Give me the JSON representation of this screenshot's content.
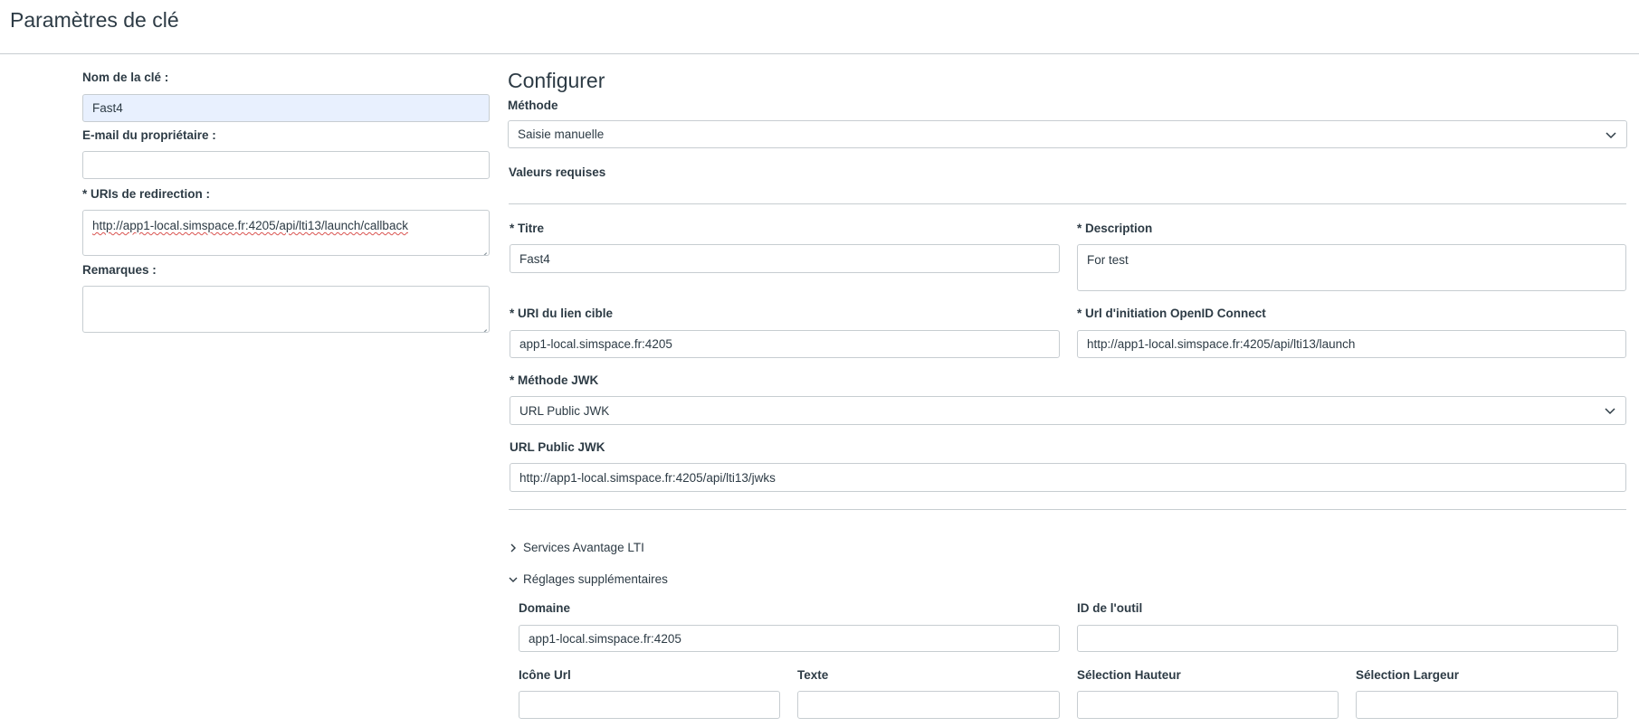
{
  "page": {
    "title": "Paramètres de clé"
  },
  "left": {
    "key_name_label": "Nom de la clé :",
    "key_name_value": "Fast4",
    "owner_email_label": "E-mail du propriétaire :",
    "owner_email_value": "",
    "redirect_uris_label": "* URIs de redirection :",
    "redirect_uris_value": "http://app1-local.simspace.fr:4205/api/lti13/launch/callback",
    "notes_label": "Remarques :",
    "notes_value": ""
  },
  "configure": {
    "title": "Configurer",
    "method_label": "Méthode",
    "method_value": "Saisie manuelle",
    "required_values_label": "Valeurs requises",
    "title_label": "* Titre",
    "title_value": "Fast4",
    "description_label": "* Description",
    "description_value": "For test",
    "target_link_label": "* URI du lien cible",
    "target_link_value": "app1-local.simspace.fr:4205",
    "openid_label": "* Url d'initiation OpenID Connect",
    "openid_value": "http://app1-local.simspace.fr:4205/api/lti13/launch",
    "jwk_method_label": "* Méthode JWK",
    "jwk_method_value": "URL Public JWK",
    "public_jwk_label": "URL Public JWK",
    "public_jwk_value": "http://app1-local.simspace.fr:4205/api/lti13/jwks"
  },
  "advantage": {
    "label": "Services Avantage LTI"
  },
  "additional": {
    "label": "Réglages supplémentaires",
    "domain_label": "Domaine",
    "domain_value": "app1-local.simspace.fr:4205",
    "tool_id_label": "ID de l'outil",
    "tool_id_value": "",
    "icon_url_label": "Icône Url",
    "icon_url_value": "",
    "text_label": "Texte",
    "text_value": "",
    "selection_height_label": "Sélection Hauteur",
    "selection_height_value": "",
    "selection_width_label": "Sélection Largeur",
    "selection_width_value": ""
  },
  "icons": {
    "select_chevron": "chevron-down-icon",
    "collapsed": "chevron-right-icon",
    "expanded": "chevron-down-icon",
    "resize_handle": "resize-handle-icon"
  },
  "colors": {
    "text": "#2d3b45",
    "border": "#c7cdd1",
    "autofill": "#e8f0fe",
    "spellcheck": "#d9534f"
  }
}
